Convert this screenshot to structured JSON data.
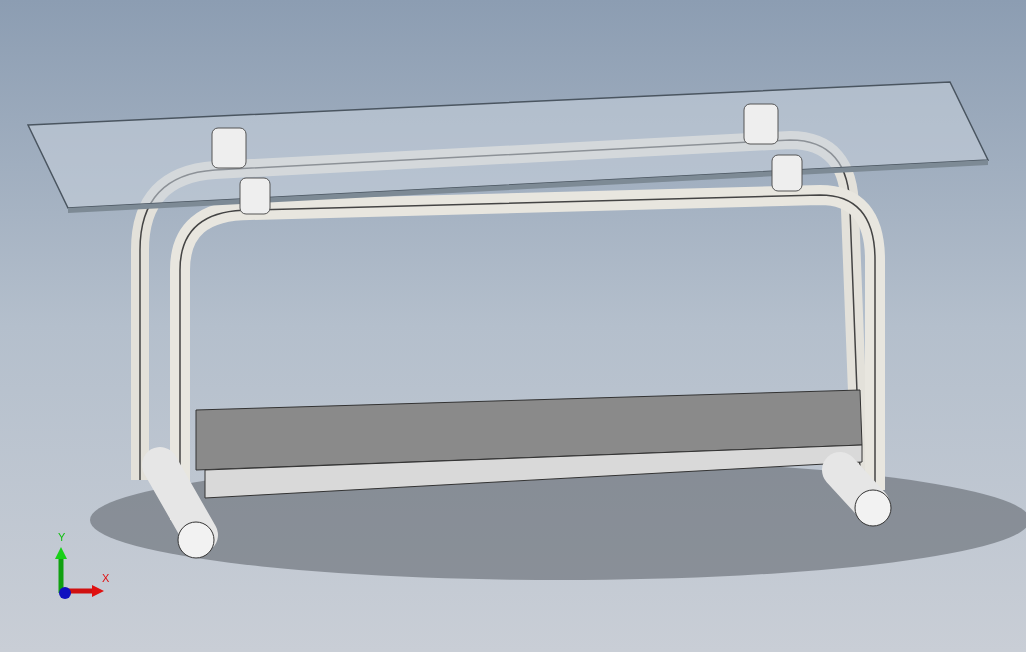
{
  "viewport": {
    "triad": {
      "axes": [
        {
          "kind": "y",
          "label": "Y"
        },
        {
          "kind": "x",
          "label": "X"
        }
      ]
    }
  }
}
